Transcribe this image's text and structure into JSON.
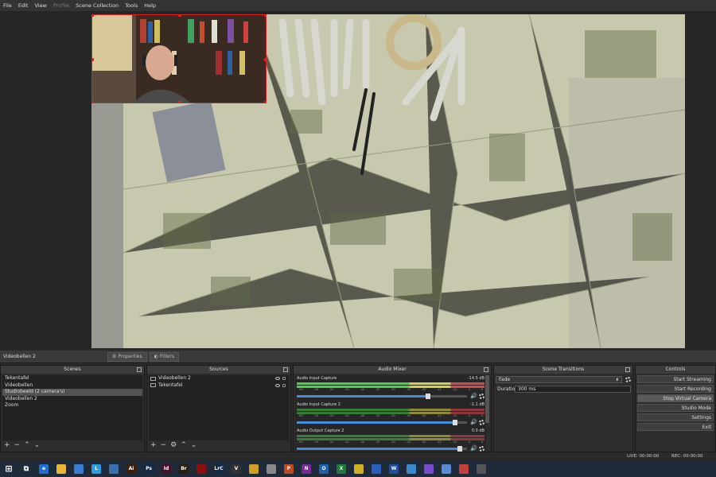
{
  "menu": [
    "File",
    "Edit",
    "View",
    "Profile",
    "Scene Collection",
    "Tools",
    "Help"
  ],
  "menu_disabled": [
    "Profile"
  ],
  "source_toolbar": {
    "current_source": "Videobellen 2",
    "properties_label": "Properties",
    "filters_label": "Filters"
  },
  "docks": {
    "scenes": {
      "title": "Scenes",
      "items": [
        "Tekentafel",
        "Videobellen",
        "Studiobeeld (2 camera's)",
        "Videobellen 2",
        "Zoom"
      ],
      "selected": "Studiobeeld (2 camera's)"
    },
    "sources": {
      "title": "Sources",
      "items": [
        "Videobellen 2",
        "Tekentafel"
      ]
    },
    "mixer": {
      "title": "Audio Mixer",
      "channels": [
        {
          "name": "Audio Input Capture",
          "db": "-14.5 dB",
          "level": 0.77
        },
        {
          "name": "Audio Input Capture 2",
          "db": "-1.1 dB",
          "level": 0.93
        },
        {
          "name": "Audio Output Capture 2",
          "db": "0.0 dB",
          "level": 0.96
        }
      ],
      "scale": [
        "-60",
        "-55",
        "-50",
        "-45",
        "-40",
        "-35",
        "-30",
        "-25",
        "-20",
        "-15",
        "-10",
        "-5",
        "0"
      ]
    },
    "transitions": {
      "title": "Scene Transitions",
      "transition": "Fade",
      "duration_label": "Duration",
      "duration_value": "300 ms"
    },
    "controls": {
      "title": "Controls",
      "buttons": [
        "Start Streaming",
        "Start Recording",
        "Stop Virtual Camera",
        "Studio Mode",
        "Settings",
        "Exit"
      ],
      "pressed": "Stop Virtual Camera"
    }
  },
  "status": {
    "live": "LIVE: 00:00:00",
    "rec": "REC: 00:00:00"
  },
  "taskbar": {
    "icons": [
      {
        "name": "windows-start-icon",
        "label": "",
        "color": "#1f2b38"
      },
      {
        "name": "task-view-icon",
        "label": "",
        "color": "#1f2b38"
      },
      {
        "name": "edge-icon",
        "label": "e",
        "color": "#1f6fd0"
      },
      {
        "name": "file-explorer-icon",
        "label": "",
        "color": "#e8b73a"
      },
      {
        "name": "store-icon",
        "label": "",
        "color": "#3a7bd5"
      },
      {
        "name": "app-l-icon",
        "label": "L",
        "color": "#2a9de0"
      },
      {
        "name": "mail-icon",
        "label": "",
        "color": "#3a6fb0"
      },
      {
        "name": "illustrator-icon",
        "label": "Ai",
        "color": "#3a1f0a"
      },
      {
        "name": "photoshop-icon",
        "label": "Ps",
        "color": "#0f2a4a"
      },
      {
        "name": "indesign-icon",
        "label": "Id",
        "color": "#4a0f2a"
      },
      {
        "name": "bridge-icon",
        "label": "Br",
        "color": "#2a1f0a"
      },
      {
        "name": "acrobat-icon",
        "label": "",
        "color": "#8a1010"
      },
      {
        "name": "lightroom-icon",
        "label": "LrC",
        "color": "#0f2a4a"
      },
      {
        "name": "vectorworks-icon",
        "label": "V",
        "color": "#333333"
      },
      {
        "name": "chrome-icon",
        "label": "",
        "color": "#d0a020"
      },
      {
        "name": "cloud-icon",
        "label": "",
        "color": "#888888"
      },
      {
        "name": "powerpoint-icon",
        "label": "P",
        "color": "#c04a20"
      },
      {
        "name": "onenote-icon",
        "label": "N",
        "color": "#7a2a9a"
      },
      {
        "name": "outlook-icon",
        "label": "O",
        "color": "#1f5fb0"
      },
      {
        "name": "excel-icon",
        "label": "X",
        "color": "#1f7a3a"
      },
      {
        "name": "app-pencil-icon",
        "label": "",
        "color": "#d0b020"
      },
      {
        "name": "app-blue-icon",
        "label": "",
        "color": "#2a5fc0"
      },
      {
        "name": "word-icon",
        "label": "W",
        "color": "#1f4fa0"
      },
      {
        "name": "app-circle-icon",
        "label": "",
        "color": "#3a8ad0"
      },
      {
        "name": "app-purple-icon",
        "label": "",
        "color": "#7a4ad0"
      },
      {
        "name": "photos-icon",
        "label": "",
        "color": "#5a8ad0"
      },
      {
        "name": "app-red-icon",
        "label": "",
        "color": "#c04040"
      },
      {
        "name": "obs-icon",
        "label": "",
        "color": "#555555"
      }
    ]
  }
}
